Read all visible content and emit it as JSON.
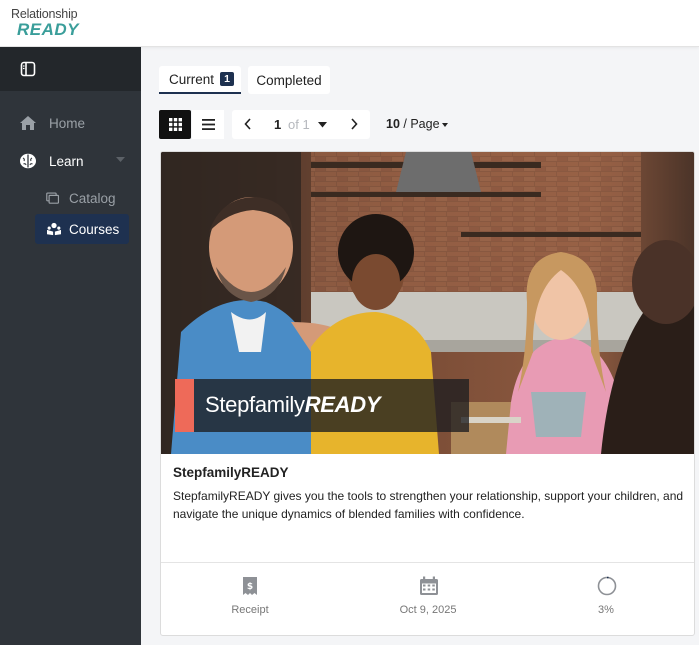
{
  "brand": {
    "line1": "Relationship",
    "line2": "READY"
  },
  "sidebar": {
    "items": [
      {
        "label": "Home",
        "icon": "home-icon"
      },
      {
        "label": "Learn",
        "icon": "brain-icon"
      },
      {
        "label": "Catalog",
        "icon": "catalog-icon"
      },
      {
        "label": "Courses",
        "icon": "courses-icon"
      }
    ]
  },
  "tabs": [
    {
      "label": "Current",
      "count": "1"
    },
    {
      "label": "Completed"
    }
  ],
  "pager": {
    "current": "1",
    "of_text": "of 1",
    "per_page_value": "10",
    "per_page_suffix": "/ Page"
  },
  "course": {
    "image_title_light": "Stepfamily",
    "image_title_bold": "READY",
    "title": "StepfamilyREADY",
    "description": "StepfamilyREADY gives you the tools to strengthen your relationship, support your children, and navigate the unique dynamics of blended families with confidence.",
    "receipt_label": "Receipt",
    "date": "Oct 9, 2025",
    "progress_text": "3%",
    "progress": 0.03
  },
  "colors": {
    "accent": "#1e3150",
    "brand_teal": "#3a9e9a",
    "sidebar_bg": "#2f343a",
    "banner_accent": "#ee6a59"
  }
}
